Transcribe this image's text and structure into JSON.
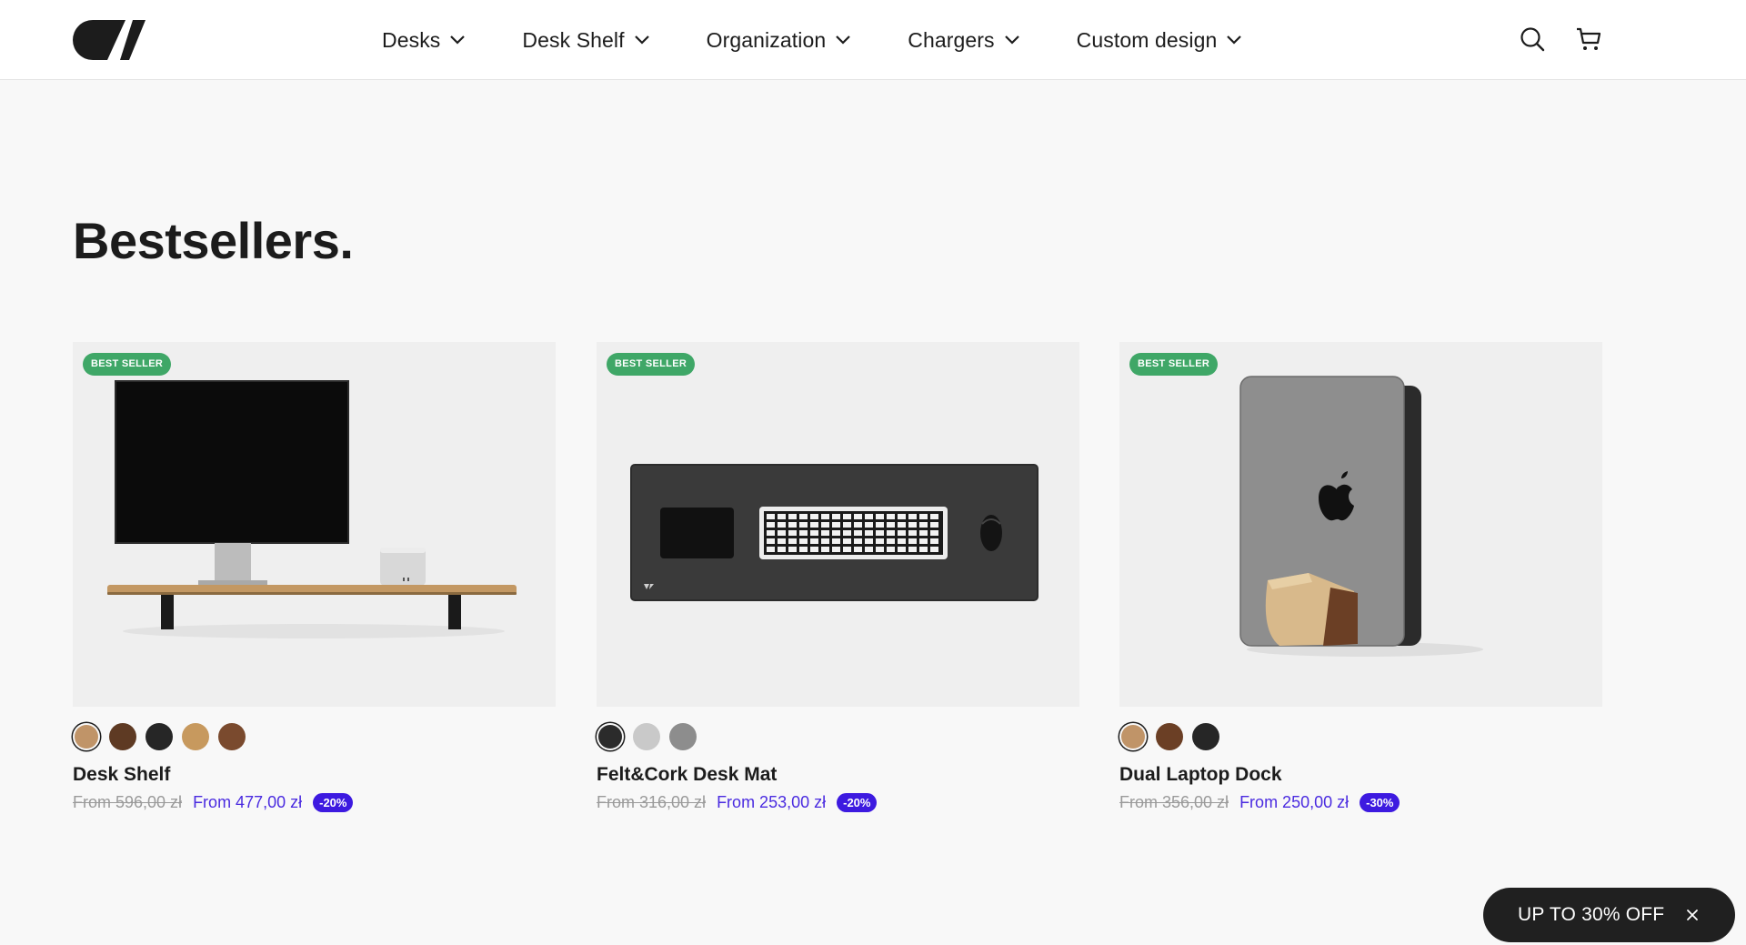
{
  "header": {
    "logo_icon": "brand-logo-icon",
    "nav": [
      {
        "label": "Desks"
      },
      {
        "label": "Desk Shelf"
      },
      {
        "label": "Organization"
      },
      {
        "label": "Chargers"
      },
      {
        "label": "Custom design"
      }
    ],
    "search_icon": "search-icon",
    "cart_icon": "cart-icon"
  },
  "section": {
    "title": "Bestsellers."
  },
  "products": [
    {
      "badge": "BEST SELLER",
      "name": "Desk Shelf",
      "old_price": "From 596,00 zł",
      "new_price": "From 477,00 zł",
      "discount": "-20%",
      "swatches": [
        "#c09468",
        "#5e3a23",
        "#262626",
        "#c7995e",
        "#7a4a2e"
      ],
      "selected_swatch": 0
    },
    {
      "badge": "BEST SELLER",
      "name": "Felt&Cork Desk Mat",
      "old_price": "From 316,00 zł",
      "new_price": "From 253,00 zł",
      "discount": "-20%",
      "swatches": [
        "#2b2b2b",
        "#c9c9c9",
        "#8d8d8d"
      ],
      "selected_swatch": 0
    },
    {
      "badge": "BEST SELLER",
      "name": "Dual Laptop Dock",
      "old_price": "From 356,00 zł",
      "new_price": "From 250,00 zł",
      "discount": "-30%",
      "swatches": [
        "#c09468",
        "#6b3f25",
        "#262626"
      ],
      "selected_swatch": 0
    }
  ],
  "promo": {
    "text": "UP TO 30% OFF",
    "close_icon": "close-icon"
  },
  "colors": {
    "accent": "#3d1ae0",
    "badge_green": "#3fa767",
    "text": "#1c1c1c",
    "background": "#f8f8f8"
  }
}
